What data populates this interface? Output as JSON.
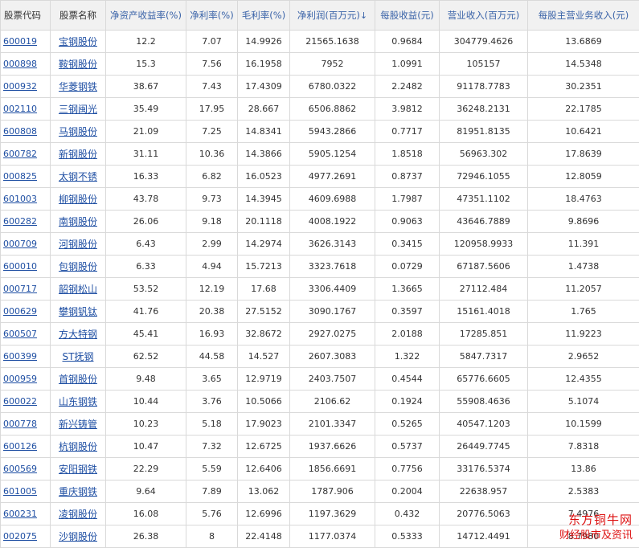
{
  "header": {
    "code": "股票代码",
    "name": "股票名称",
    "roe": "净资产收益率(%)",
    "net_margin": "净利率(%)",
    "gross_margin": "毛利率(%)",
    "net_profit": "净利润(百万元)",
    "sort_arrow": "↓",
    "eps": "每股收益(元)",
    "revenue": "营业收入(百万元)",
    "rev_per_share": "每股主营业务收入(元)"
  },
  "rows": [
    {
      "code": "600019",
      "name": "宝钢股份",
      "roe": "12.2",
      "net_margin": "7.07",
      "gross_margin": "14.9926",
      "net_profit": "21565.1638",
      "eps": "0.9684",
      "revenue": "304779.4626",
      "rev_per_share": "13.6869"
    },
    {
      "code": "000898",
      "name": "鞍钢股份",
      "roe": "15.3",
      "net_margin": "7.56",
      "gross_margin": "16.1958",
      "net_profit": "7952",
      "eps": "1.0991",
      "revenue": "105157",
      "rev_per_share": "14.5348"
    },
    {
      "code": "000932",
      "name": "华菱钢铁",
      "roe": "38.67",
      "net_margin": "7.43",
      "gross_margin": "17.4309",
      "net_profit": "6780.0322",
      "eps": "2.2482",
      "revenue": "91178.7783",
      "rev_per_share": "30.2351"
    },
    {
      "code": "002110",
      "name": "三钢闽光",
      "roe": "35.49",
      "net_margin": "17.95",
      "gross_margin": "28.667",
      "net_profit": "6506.8862",
      "eps": "3.9812",
      "revenue": "36248.2131",
      "rev_per_share": "22.1785"
    },
    {
      "code": "600808",
      "name": "马钢股份",
      "roe": "21.09",
      "net_margin": "7.25",
      "gross_margin": "14.8341",
      "net_profit": "5943.2866",
      "eps": "0.7717",
      "revenue": "81951.8135",
      "rev_per_share": "10.6421"
    },
    {
      "code": "600782",
      "name": "新钢股份",
      "roe": "31.11",
      "net_margin": "10.36",
      "gross_margin": "14.3866",
      "net_profit": "5905.1254",
      "eps": "1.8518",
      "revenue": "56963.302",
      "rev_per_share": "17.8639"
    },
    {
      "code": "000825",
      "name": "太钢不锈",
      "roe": "16.33",
      "net_margin": "6.82",
      "gross_margin": "16.0523",
      "net_profit": "4977.2691",
      "eps": "0.8737",
      "revenue": "72946.1055",
      "rev_per_share": "12.8059"
    },
    {
      "code": "601003",
      "name": "柳钢股份",
      "roe": "43.78",
      "net_margin": "9.73",
      "gross_margin": "14.3945",
      "net_profit": "4609.6988",
      "eps": "1.7987",
      "revenue": "47351.1102",
      "rev_per_share": "18.4763"
    },
    {
      "code": "600282",
      "name": "南钢股份",
      "roe": "26.06",
      "net_margin": "9.18",
      "gross_margin": "20.1118",
      "net_profit": "4008.1922",
      "eps": "0.9063",
      "revenue": "43646.7889",
      "rev_per_share": "9.8696"
    },
    {
      "code": "000709",
      "name": "河钢股份",
      "roe": "6.43",
      "net_margin": "2.99",
      "gross_margin": "14.2974",
      "net_profit": "3626.3143",
      "eps": "0.3415",
      "revenue": "120958.9933",
      "rev_per_share": "11.391"
    },
    {
      "code": "600010",
      "name": "包钢股份",
      "roe": "6.33",
      "net_margin": "4.94",
      "gross_margin": "15.7213",
      "net_profit": "3323.7618",
      "eps": "0.0729",
      "revenue": "67187.5606",
      "rev_per_share": "1.4738"
    },
    {
      "code": "000717",
      "name": "韶钢松山",
      "roe": "53.52",
      "net_margin": "12.19",
      "gross_margin": "17.68",
      "net_profit": "3306.4409",
      "eps": "1.3665",
      "revenue": "27112.484",
      "rev_per_share": "11.2057"
    },
    {
      "code": "000629",
      "name": "攀钢钒钛",
      "roe": "41.76",
      "net_margin": "20.38",
      "gross_margin": "27.5152",
      "net_profit": "3090.1767",
      "eps": "0.3597",
      "revenue": "15161.4018",
      "rev_per_share": "1.765"
    },
    {
      "code": "600507",
      "name": "方大特钢",
      "roe": "45.41",
      "net_margin": "16.93",
      "gross_margin": "32.8672",
      "net_profit": "2927.0275",
      "eps": "2.0188",
      "revenue": "17285.851",
      "rev_per_share": "11.9223"
    },
    {
      "code": "600399",
      "name": "ST抚钢",
      "roe": "62.52",
      "net_margin": "44.58",
      "gross_margin": "14.527",
      "net_profit": "2607.3083",
      "eps": "1.322",
      "revenue": "5847.7317",
      "rev_per_share": "2.9652"
    },
    {
      "code": "000959",
      "name": "首钢股份",
      "roe": "9.48",
      "net_margin": "3.65",
      "gross_margin": "12.9719",
      "net_profit": "2403.7507",
      "eps": "0.4544",
      "revenue": "65776.6605",
      "rev_per_share": "12.4355"
    },
    {
      "code": "600022",
      "name": "山东钢铁",
      "roe": "10.44",
      "net_margin": "3.76",
      "gross_margin": "10.5066",
      "net_profit": "2106.62",
      "eps": "0.1924",
      "revenue": "55908.4636",
      "rev_per_share": "5.1074"
    },
    {
      "code": "000778",
      "name": "新兴铸管",
      "roe": "10.23",
      "net_margin": "5.18",
      "gross_margin": "17.9023",
      "net_profit": "2101.3347",
      "eps": "0.5265",
      "revenue": "40547.1203",
      "rev_per_share": "10.1599"
    },
    {
      "code": "600126",
      "name": "杭钢股份",
      "roe": "10.47",
      "net_margin": "7.32",
      "gross_margin": "12.6725",
      "net_profit": "1937.6626",
      "eps": "0.5737",
      "revenue": "26449.7745",
      "rev_per_share": "7.8318"
    },
    {
      "code": "600569",
      "name": "安阳钢铁",
      "roe": "22.29",
      "net_margin": "5.59",
      "gross_margin": "12.6406",
      "net_profit": "1856.6691",
      "eps": "0.7756",
      "revenue": "33176.5374",
      "rev_per_share": "13.86"
    },
    {
      "code": "601005",
      "name": "重庆钢铁",
      "roe": "9.64",
      "net_margin": "7.89",
      "gross_margin": "13.062",
      "net_profit": "1787.906",
      "eps": "0.2004",
      "revenue": "22638.957",
      "rev_per_share": "2.5383"
    },
    {
      "code": "600231",
      "name": "凌钢股份",
      "roe": "16.08",
      "net_margin": "5.76",
      "gross_margin": "12.6996",
      "net_profit": "1197.3629",
      "eps": "0.432",
      "revenue": "20776.5063",
      "rev_per_share": "7.4976"
    },
    {
      "code": "002075",
      "name": "沙钢股份",
      "roe": "26.38",
      "net_margin": "8",
      "gross_margin": "22.4148",
      "net_profit": "1177.0374",
      "eps": "0.5333",
      "revenue": "14712.4491",
      "rev_per_share": "8.7980"
    }
  ],
  "watermark": {
    "line1": "东方铜牛网",
    "line2": "财经股市及资讯"
  }
}
